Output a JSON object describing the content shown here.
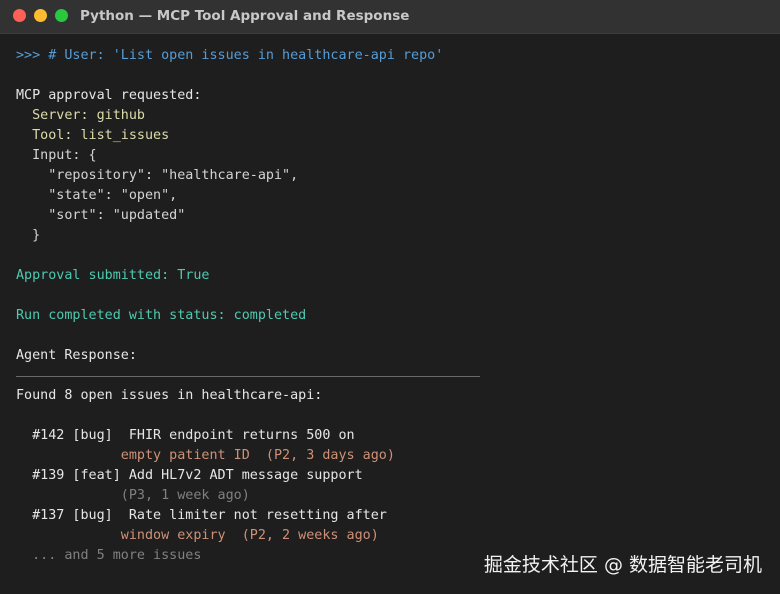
{
  "window": {
    "title": "Python — MCP Tool Approval and Response",
    "controls": [
      "close",
      "minimize",
      "zoom"
    ]
  },
  "terminal": {
    "prompt_line": ">>> # User: 'List open issues in healthcare-api repo'",
    "approval_header": "MCP approval requested:",
    "server_line": "  Server: github",
    "tool_line": "  Tool: list_issues",
    "input_open": "  Input: {",
    "input_lines": [
      "    \"repository\": \"healthcare-api\",",
      "    \"state\": \"open\",",
      "    \"sort\": \"updated\""
    ],
    "input_close": "  }",
    "approval_submitted": "Approval submitted: True",
    "run_status": "Run completed with status: completed",
    "agent_response_label": "Agent Response:",
    "found_line": "Found 8 open issues in healthcare-api:",
    "issues": [
      {
        "line1": "  #142 [bug]  FHIR endpoint returns 500 on",
        "line2": "             empty patient ID  (P2, 3 days ago)"
      },
      {
        "line1": "  #139 [feat] Add HL7v2 ADT message support",
        "line2": "             (P3, 1 week ago)"
      },
      {
        "line1": "  #137 [bug]  Rate limiter not resetting after",
        "line2": "             window expiry  (P2, 2 weeks ago)"
      }
    ],
    "more_line": "  ... and 5 more issues"
  },
  "watermark": "掘金技术社区 @ 数据智能老司机",
  "colors": {
    "background": "#1e1e1e",
    "titlebar": "#323232",
    "prompt": "#569cd6",
    "keys": "#dcdcaa",
    "success": "#4ec9b0",
    "highlight": "#ce9178",
    "muted": "#808080"
  }
}
